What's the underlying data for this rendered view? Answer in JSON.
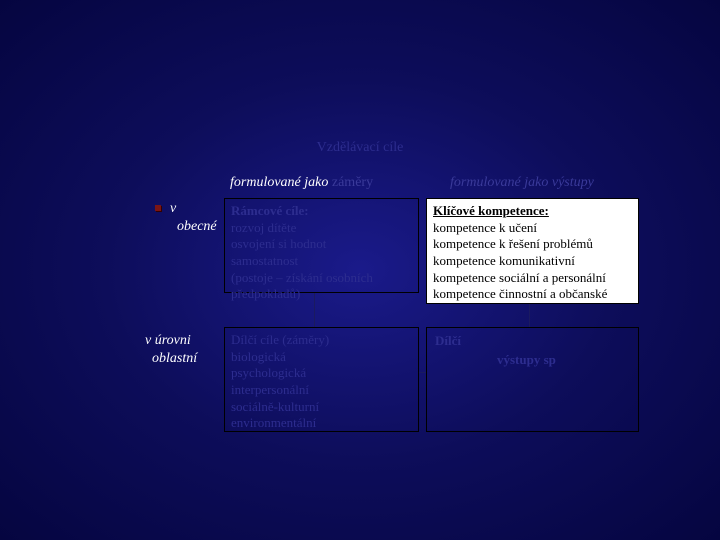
{
  "subtitle": "Vzdělávací cíle",
  "header": {
    "left_italic": "formulované jako",
    "left_dim": " záměry",
    "right": "formulované jako výstupy"
  },
  "rows": {
    "r1": {
      "prefix": "v",
      "line2": "obecné"
    },
    "r2": {
      "line1": "v úrovni",
      "line2": "oblastní"
    }
  },
  "boxA": {
    "title": "Rámcové cíle:",
    "l1": "rozvoj dítěte",
    "l2": "osvojení si hodnot",
    "l3": "samostatnost",
    "l4": "(postoje – získání osobních předpokladů)"
  },
  "boxB": {
    "title": "Klíčové kompetence:",
    "l1": "kompetence k učení",
    "l2": "kompetence k řešení problémů",
    "l3": "kompetence komunikativní",
    "l4": "kompetence sociální a personální",
    "l5": "kompetence činnostní a občanské"
  },
  "boxC": {
    "title": "Dílčí cíle (záměry)",
    "l1": "biologická",
    "l2": "psychologická",
    "l3": "interpersonální",
    "l4": "sociálně-kulturní",
    "l5": "environmentální"
  },
  "boxD": {
    "frag1": "Dílčí",
    "frag2": "výstupy sp"
  }
}
